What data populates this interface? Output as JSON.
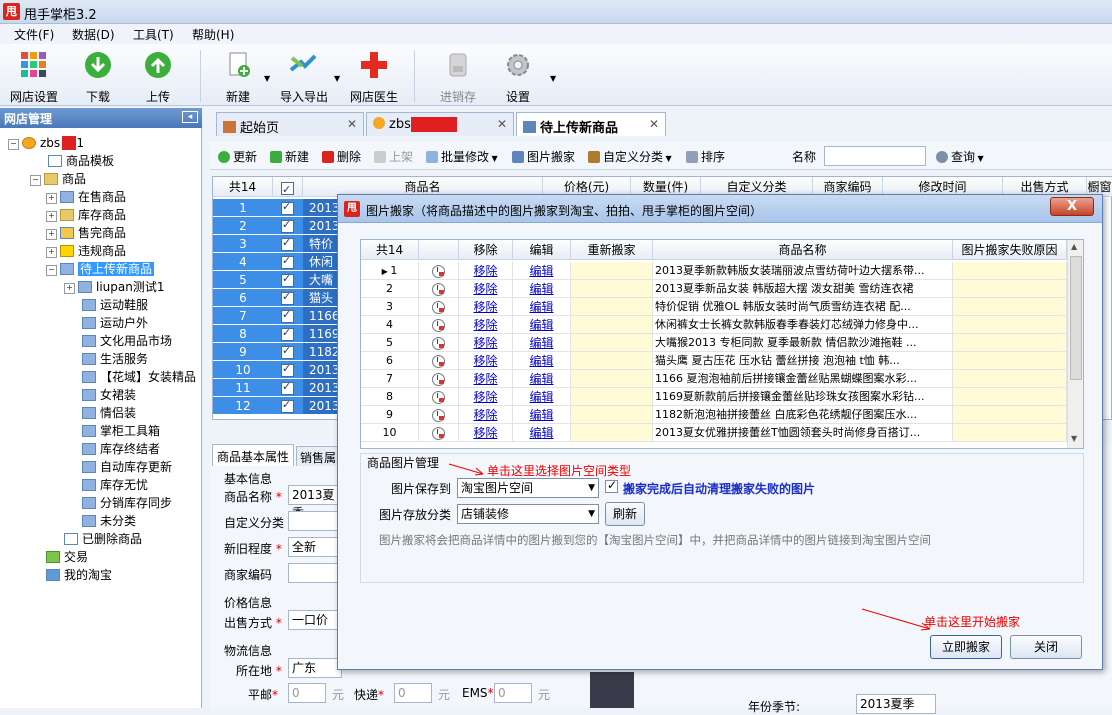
{
  "window": {
    "title": "甩手掌柜3.2",
    "logo": "甩"
  },
  "menu": [
    "文件(F)",
    "数据(D)",
    "工具(T)",
    "帮助(H)"
  ],
  "toolbar": {
    "shop_settings": "网店设置",
    "download": "下载",
    "upload": "上传",
    "new": "新建",
    "import_export": "导入导出",
    "doctor": "网店医生",
    "inventory": "进销存",
    "settings": "设置"
  },
  "left": {
    "header": "网店管理",
    "root": "zbs",
    "template": "商品模板",
    "goods": "商品",
    "on_sale": "在售商品",
    "stock": "库存商品",
    "sold_out": "售完商品",
    "violation": "违规商品",
    "pending": "待上传新商品",
    "cats": [
      "liupan测试1",
      "运动鞋服",
      "运动户外",
      "文化用品市场",
      "生活服务",
      "【花域】女装精品",
      "女裙装",
      "情侣装",
      "掌柜工具箱",
      "库存终结者",
      "自动库存更新",
      "库存无忧",
      "分销库存同步",
      "未分类"
    ],
    "deleted": "已删除商品",
    "trade": "交易",
    "my_taobao": "我的淘宝"
  },
  "tabs": [
    {
      "label": "起始页"
    },
    {
      "label": "zbs"
    },
    {
      "label": "待上传新商品"
    }
  ],
  "tb2": {
    "refresh": "更新",
    "new": "新建",
    "delete": "删除",
    "shelve": "上架",
    "batch": "批量修改",
    "mover": "图片搬家",
    "custom_cat": "自定义分类",
    "sort": "排序",
    "name_label": "名称",
    "query": "查询"
  },
  "bggrid": {
    "count": "共14",
    "headers": [
      "商品名",
      "价格(元)",
      "数量(件)",
      "自定义分类",
      "商家编码",
      "修改时间",
      "出售方式",
      "橱窗"
    ],
    "rows": [
      {
        "n": "1",
        "t": "2013"
      },
      {
        "n": "2",
        "t": "2013"
      },
      {
        "n": "3",
        "t": "特价"
      },
      {
        "n": "4",
        "t": "休闲"
      },
      {
        "n": "5",
        "t": "大嘴"
      },
      {
        "n": "6",
        "t": "猫头"
      },
      {
        "n": "7",
        "t": "1166"
      },
      {
        "n": "8",
        "t": "1169"
      },
      {
        "n": "9",
        "t": "1182"
      },
      {
        "n": "10",
        "t": "2013"
      },
      {
        "n": "11",
        "t": "2013"
      },
      {
        "n": "12",
        "t": "2013"
      }
    ]
  },
  "lower": {
    "tab1": "商品基本属性",
    "tab2": "销售属",
    "basic_info": "基本信息",
    "name_label": "商品名称",
    "name_value": "2013夏季",
    "custom_cat": "自定义分类",
    "condition": "新旧程度",
    "condition_value": "全新",
    "merchant_code": "商家编码",
    "price_info": "价格信息",
    "sale_mode": "出售方式",
    "sale_mode_value": "一口价",
    "logistics": "物流信息",
    "location": "所在地",
    "location_value": "广东",
    "post": "平邮",
    "express": "快递",
    "ems": "EMS",
    "zero": "0",
    "yuan": "元",
    "season_label": "年份季节:",
    "season_value": "2013夏季"
  },
  "dialog": {
    "logo": "甩",
    "title": "图片搬家（将商品描述中的图片搬家到淘宝、拍拍、甩手掌柜的图片空间）",
    "count": "共14",
    "headers": [
      "移除",
      "编辑",
      "重新搬家",
      "商品名称",
      "图片搬家失败原因"
    ],
    "remove": "移除",
    "edit": "编辑",
    "rows": [
      {
        "n": "1",
        "name": "2013夏季新款韩版女装瑞丽波点雪纺荷叶边大摆系带..."
      },
      {
        "n": "2",
        "name": "2013夏季新品女装 韩版超大摆 泼女甜美 雪纺连衣裙"
      },
      {
        "n": "3",
        "name": "特价促销 优雅OL 韩版女装时尚气质雪纺连衣裙 配..."
      },
      {
        "n": "4",
        "name": "休闲裤女士长裤女款韩版春季春装灯芯绒弹力修身中..."
      },
      {
        "n": "5",
        "name": "大嘴猴2013 专柜同款 夏季最新款 情侣款沙滩拖鞋 ..."
      },
      {
        "n": "6",
        "name": "猫头鹰 夏古压花 压水钻 蕾丝拼接 泡泡袖 t恤 韩..."
      },
      {
        "n": "7",
        "name": "1166 夏泡泡袖前后拼接镶金蕾丝贴黑蝴蝶图案水彩..."
      },
      {
        "n": "8",
        "name": "1169夏新款前后拼接镶金蕾丝贴珍珠女孩图案水彩钻..."
      },
      {
        "n": "9",
        "name": "1182新泡泡袖拼接蕾丝 白底彩色花绣靓仔图案压水..."
      },
      {
        "n": "10",
        "name": "2013夏女优雅拼接蕾丝T恤圆领套头时尚修身百搭订..."
      }
    ],
    "mgmt_title": "商品图片管理",
    "save_to_label": "图片保存到",
    "save_to_value": "淘宝图片空间",
    "auto_clean": "搬家完成后自动清理搬家失败的图片",
    "category_label": "图片存放分类",
    "category_value": "店铺装修",
    "refresh": "刷新",
    "description": "图片搬家将会把商品详情中的图片搬到您的【淘宝图片空间】中，并把商品详情中的图片链接到淘宝图片空间",
    "note_select": "单击这里选择图片空间类型",
    "note_start": "单击这里开始搬家",
    "start": "立即搬家",
    "close": "关闭",
    "close_x": "X"
  },
  "colors": {
    "selection": "#3d8ee6",
    "accent_red": "#d9251d",
    "link": "#0000cc"
  }
}
